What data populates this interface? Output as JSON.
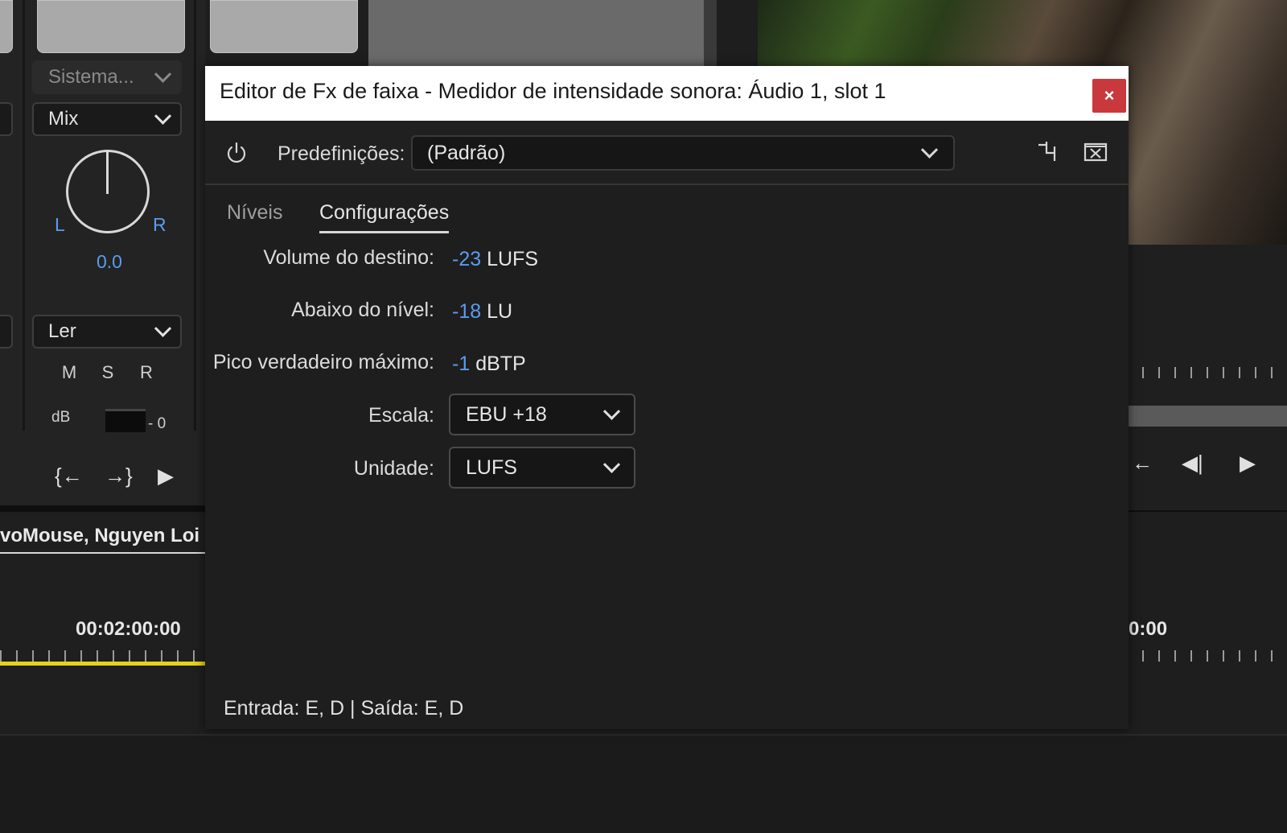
{
  "background": {
    "mixer": {
      "input_dropdown": "Sistema...",
      "mix_dropdown": "Mix",
      "pan_left": "L",
      "pan_right": "R",
      "pan_value": "0.0",
      "automation_dropdown": "Ler",
      "mute": "M",
      "solo": "S",
      "record": "R",
      "db_label": "dB",
      "meter_zero": "- 0",
      "transport": {
        "prev_icon": "go-to-in-icon",
        "next_icon": "go-to-out-icon",
        "play_icon": "play-icon"
      }
    },
    "timeline": {
      "sequence_tab": "voMouse, Nguyen Loi",
      "timecode": "00:02:00:00"
    },
    "program": {
      "timecode_partial": "0:00"
    }
  },
  "dialog": {
    "title": "Editor de Fx de faixa - Medidor de intensidade sonora: Áudio 1, slot 1",
    "close_label": "×",
    "toolbar": {
      "presets_label": "Predefinições:",
      "presets_value": "(Padrão)"
    },
    "tabs": [
      {
        "label": "Níveis",
        "active": false
      },
      {
        "label": "Configurações",
        "active": true
      }
    ],
    "settings": {
      "target_volume": {
        "label": "Volume do destino:",
        "value": "-23",
        "unit": "LUFS"
      },
      "below_level": {
        "label": "Abaixo do nível:",
        "value": "-18",
        "unit": "LU"
      },
      "max_true_peak": {
        "label": "Pico verdadeiro máximo:",
        "value": "-1",
        "unit": "dBTP"
      },
      "scale": {
        "label": "Escala:",
        "value": "EBU +18"
      },
      "unit": {
        "label": "Unidade:",
        "value": "LUFS"
      }
    },
    "footer": "Entrada: E, D | Saída: E, D"
  },
  "colors": {
    "value_blue": "#5a9cf0",
    "close_red": "#c9383d",
    "timeline_yellow": "#e6d21a"
  }
}
